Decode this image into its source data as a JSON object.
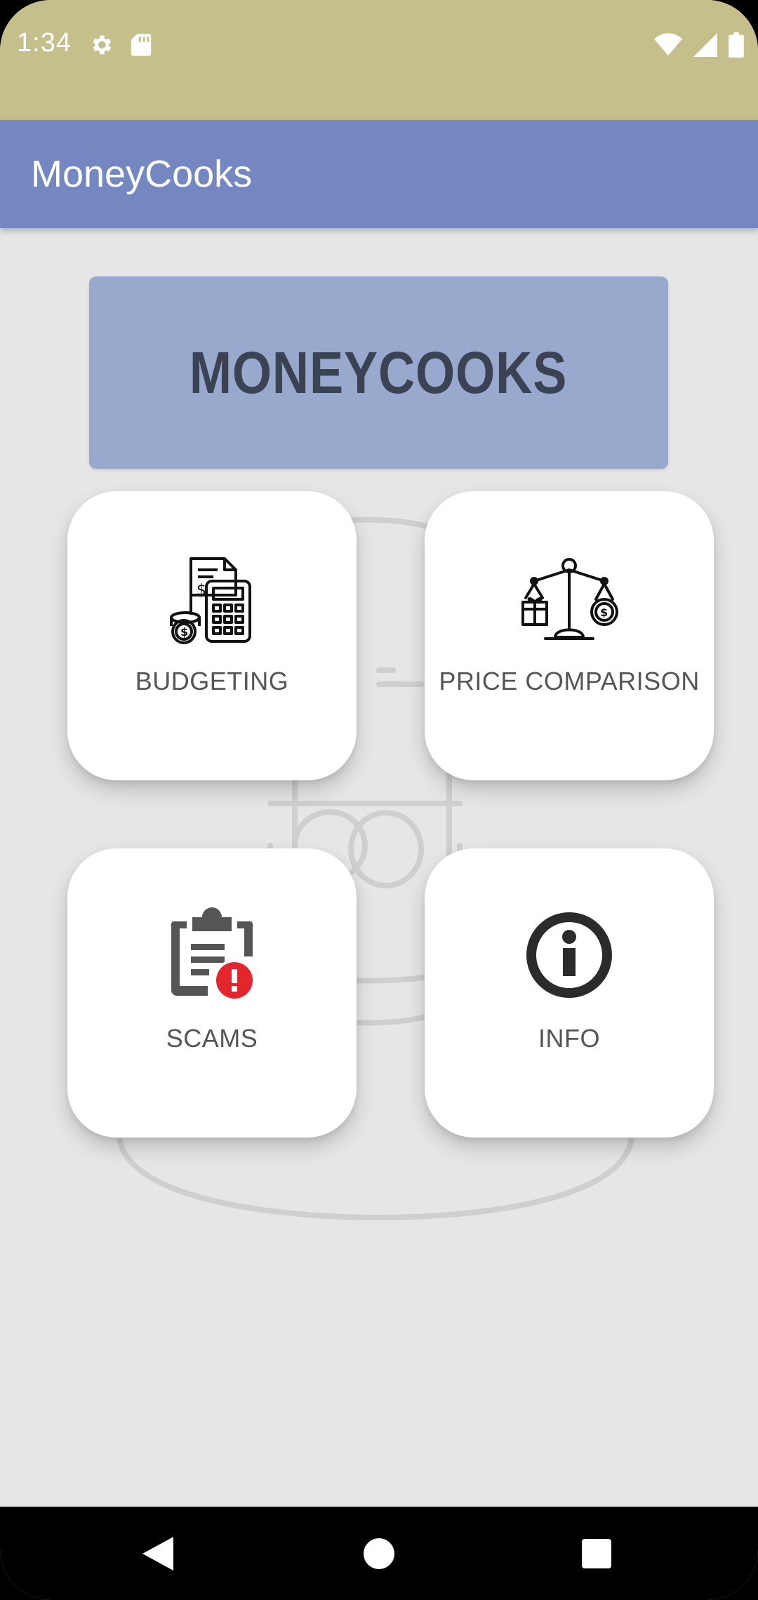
{
  "status_bar": {
    "time": "1:34",
    "icons": [
      "settings-gear-icon",
      "sd-card-icon",
      "wifi-icon",
      "cell-signal-icon",
      "battery-icon"
    ]
  },
  "app_bar": {
    "title": "MoneyCooks"
  },
  "banner": {
    "text": "MONEYCOOKS"
  },
  "cards": [
    {
      "label": "BUDGETING",
      "icon": "budget-calculator-icon"
    },
    {
      "label": "PRICE COMPARISON",
      "icon": "balance-scale-icon"
    },
    {
      "label": "SCAMS",
      "icon": "clipboard-alert-icon"
    },
    {
      "label": "INFO",
      "icon": "info-icon"
    }
  ],
  "nav_bar": {
    "buttons": [
      "back-icon",
      "home-icon",
      "recents-icon"
    ]
  },
  "colors": {
    "status_bar": "#c5bf8b",
    "app_bar": "#7587c0",
    "banner": "#98a9cd",
    "background": "#e6e6e6",
    "alert_red": "#e3262b"
  }
}
